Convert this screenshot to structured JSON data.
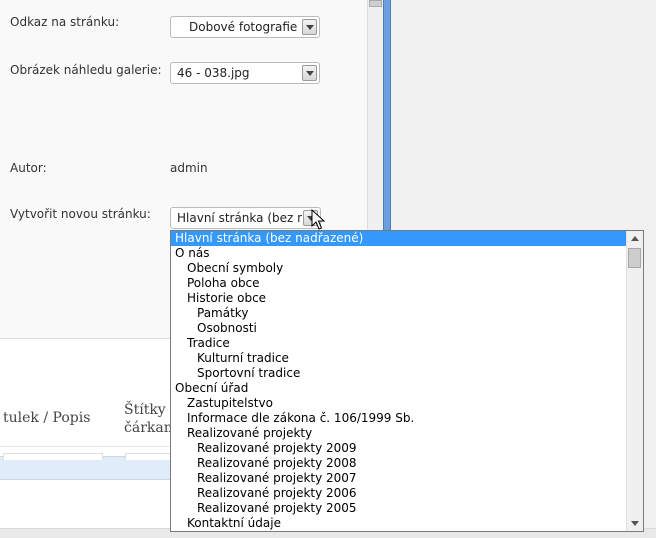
{
  "form": {
    "link_label": "Odkaz na stránku:",
    "link_value": "Dobové fotografie",
    "thumb_label": "Obrázek náhledu galerie:",
    "thumb_value": "46 - 038.jpg",
    "author_label": "Autor:",
    "author_value": "admin",
    "newpage_label": "Vytvořit novou stránku:",
    "newpage_value": "Hlavní stránka (bez nad"
  },
  "table": {
    "col_caption": "tulek / Popis",
    "col_tags_line1": "Štítky (",
    "col_tags_line2": "čárkam"
  },
  "dropdown": {
    "items": [
      {
        "label": "Hlavní stránka (bez nadřazené)",
        "level": 0,
        "selected": true
      },
      {
        "label": "O nás",
        "level": 0
      },
      {
        "label": "Obecní symboly",
        "level": 1
      },
      {
        "label": "Poloha obce",
        "level": 1
      },
      {
        "label": "Historie obce",
        "level": 1
      },
      {
        "label": "Památky",
        "level": 2
      },
      {
        "label": "Osobnosti",
        "level": 2
      },
      {
        "label": "Tradice",
        "level": 1
      },
      {
        "label": "Kulturní tradice",
        "level": 2
      },
      {
        "label": "Sportovní tradice",
        "level": 2
      },
      {
        "label": "Obecní úřad",
        "level": 0
      },
      {
        "label": "Zastupitelstvo",
        "level": 1
      },
      {
        "label": "Informace dle zákona č. 106/1999 Sb.",
        "level": 1
      },
      {
        "label": "Realizované projekty",
        "level": 1
      },
      {
        "label": "Realizované projekty 2009",
        "level": 2
      },
      {
        "label": "Realizované projekty 2008",
        "level": 2
      },
      {
        "label": "Realizované projekty 2007",
        "level": 2
      },
      {
        "label": "Realizované projekty 2006",
        "level": 2
      },
      {
        "label": "Realizované projekty 2005",
        "level": 2
      },
      {
        "label": "Kontaktní údaje",
        "level": 1
      }
    ]
  },
  "colors": {
    "selection": "#3399ff",
    "accent_bar": "#6d9fdc"
  }
}
